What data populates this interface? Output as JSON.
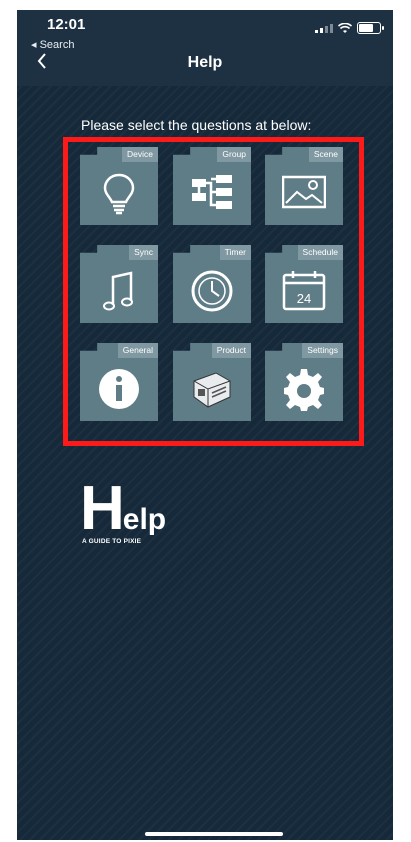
{
  "status_bar": {
    "time": "12:01",
    "back_app": "◂ Search"
  },
  "nav": {
    "back_icon": "chevron-left-icon",
    "title": "Help"
  },
  "prompt": "Please select the questions at below:",
  "tiles": [
    {
      "label": "Device",
      "icon": "lightbulb-icon"
    },
    {
      "label": "Group",
      "icon": "hierarchy-icon"
    },
    {
      "label": "Scene",
      "icon": "image-icon"
    },
    {
      "label": "Sync",
      "icon": "music-note-icon"
    },
    {
      "label": "Timer",
      "icon": "clock-icon"
    },
    {
      "label": "Schedule",
      "icon": "calendar-icon",
      "icon_text": "24"
    },
    {
      "label": "General",
      "icon": "info-icon"
    },
    {
      "label": "Product",
      "icon": "device-icon"
    },
    {
      "label": "Settings",
      "icon": "gear-icon"
    }
  ],
  "logo": {
    "initial": "H",
    "rest": "elp",
    "tagline": "A GUIDE TO PIXIE"
  },
  "colors": {
    "background": "#16293a",
    "tile": "#5f7d87",
    "tile_tab": "#7f98a1",
    "highlight": "#ff1a1a"
  }
}
